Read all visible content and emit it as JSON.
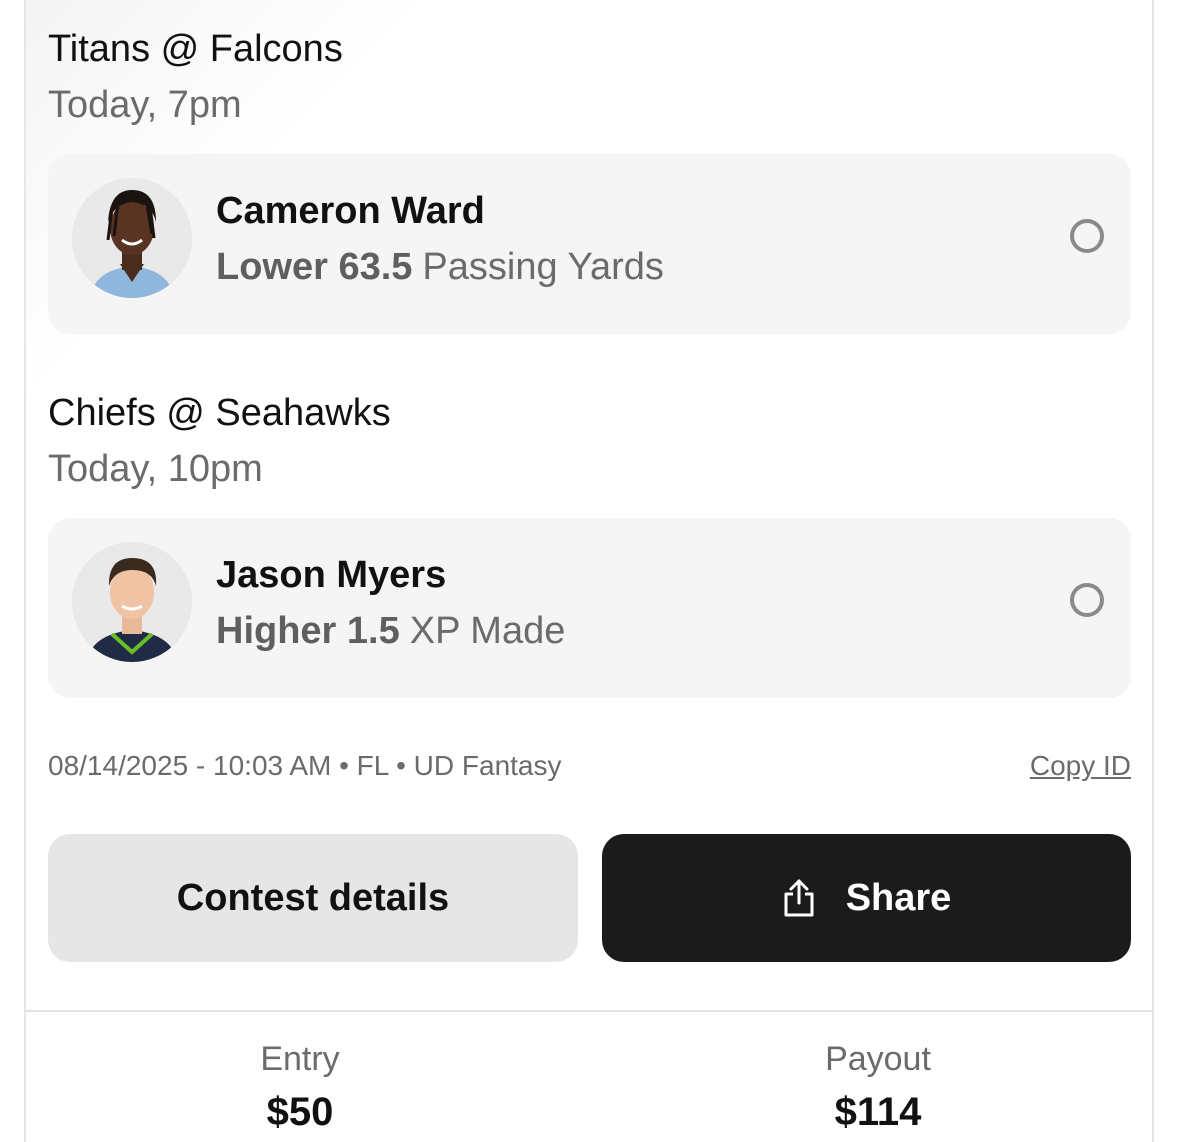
{
  "games": [
    {
      "title": "Titans @ Falcons",
      "time": "Today, 7pm",
      "pick": {
        "player_name": "Cameron Ward",
        "direction": "Lower 63.5",
        "stat": "Passing Yards",
        "avatar_icon": "player-headshot-icon"
      }
    },
    {
      "title": "Chiefs @ Seahawks",
      "time": "Today, 10pm",
      "pick": {
        "player_name": "Jason Myers",
        "direction": "Higher 1.5",
        "stat": "XP Made",
        "avatar_icon": "player-headshot-icon"
      }
    }
  ],
  "meta": {
    "info": "08/14/2025 - 10:03 AM • FL • UD Fantasy",
    "copy_id_label": "Copy ID"
  },
  "actions": {
    "contest_details_label": "Contest details",
    "share_label": "Share",
    "share_icon": "share-icon"
  },
  "summary": {
    "entry_label": "Entry",
    "entry_value": "$50",
    "payout_label": "Payout",
    "payout_value": "$114"
  },
  "colors": {
    "card_bg": "#f5f5f5",
    "share_button_bg": "#1b1b1b",
    "contest_button_bg": "#e6e6e6",
    "muted_text": "#6b6b6b"
  }
}
